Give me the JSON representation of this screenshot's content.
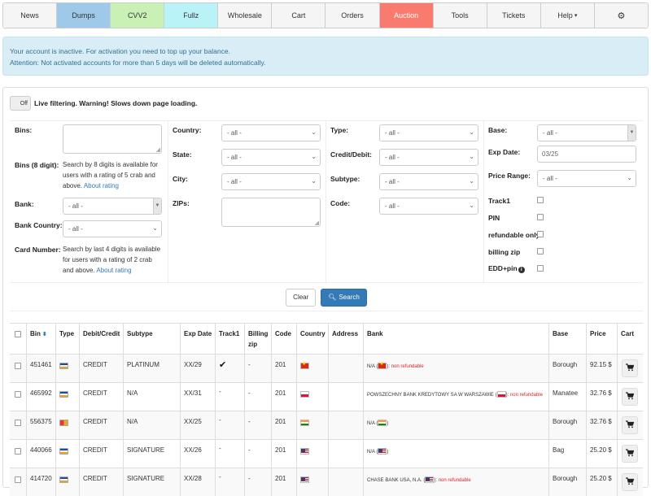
{
  "nav": {
    "tabs": [
      {
        "label": "News",
        "bg": "#f5f5f5",
        "active": false
      },
      {
        "label": "Dumps",
        "bg": "#9fc9e8",
        "active": true
      },
      {
        "label": "CVV2",
        "bg": "#c9f0b5",
        "active": false
      },
      {
        "label": "Fullz",
        "bg": "#b9f2f7",
        "active": false
      },
      {
        "label": "Wholesale",
        "bg": "#f5f5f5",
        "active": false
      },
      {
        "label": "Cart",
        "bg": "#f5f5f5",
        "active": false
      },
      {
        "label": "Orders",
        "bg": "#f5f5f5",
        "active": false
      },
      {
        "label": "Auction",
        "bg": "#f97b70",
        "active": false,
        "color": "#ffffff"
      },
      {
        "label": "Tools",
        "bg": "#f5f5f5",
        "active": false
      },
      {
        "label": "Tickets",
        "bg": "#f5f5f5",
        "active": false
      },
      {
        "label": "Help",
        "bg": "#f5f5f5",
        "active": false,
        "dropdown": true
      },
      {
        "label": "",
        "bg": "#f5f5f5",
        "active": false,
        "icon": "gear-icon"
      }
    ]
  },
  "alert": {
    "line1_prefix": "Your account is inactive. For activation you need ",
    "line1_link": "to top up your balance.",
    "line2": "Attention: Not activated accounts for more than 5 days will be deleted automatically."
  },
  "live_filter": {
    "toggle_label": "Off",
    "text": "Live filtering. Warning! Slows down page loading."
  },
  "filters": {
    "bins_label": "Bins:",
    "bins8_label": "Bins (8 digit):",
    "bins8_help": "Search by 8 digits is available for users with a rating of 5 crab and above.",
    "about_rating": "About rating",
    "bank_label": "Bank:",
    "bank_value": "- all -",
    "bank_country_label": "Bank Country:",
    "bank_country_value": "- all -",
    "card_number_label": "Card Number:",
    "card_number_help": "Search by last 4 digits is available for users with a rating of 2 crab and above.",
    "country_label": "Country:",
    "country_value": "- all -",
    "state_label": "State:",
    "state_value": "- all -",
    "city_label": "City:",
    "city_value": "- all -",
    "zips_label": "ZIPs:",
    "type_label": "Type:",
    "type_value": "- all -",
    "credit_debit_label": "Credit/Debit:",
    "credit_debit_value": "- all -",
    "subtype_label": "Subtype:",
    "subtype_value": "- all -",
    "code_label": "Code:",
    "code_value": "- all -",
    "base_label": "Base:",
    "base_value": "- all -",
    "exp_date_label": "Exp Date:",
    "exp_date_placeholder": "03/25",
    "price_range_label": "Price Range:",
    "price_range_value": "- all -",
    "track1_label": "Track1",
    "pin_label": "PIN",
    "refundable_label": "refundable only",
    "billing_zip_label": "billing zip",
    "edd_pin_label": "EDD+pin"
  },
  "buttons": {
    "clear": "Clear",
    "search": "Search"
  },
  "table": {
    "headers": {
      "bin": "Bin",
      "type": "Type",
      "debit_credit": "Debit/Credit",
      "subtype": "Subtype",
      "exp_date": "Exp Date",
      "track1": "Track1",
      "billing_zip_1": "Billing",
      "billing_zip_2": "zip",
      "code": "Code",
      "country": "Country",
      "address": "Address",
      "bank": "Bank",
      "base": "Base",
      "price": "Price",
      "cart": "Cart"
    },
    "rows": [
      {
        "bin": "451461",
        "card": "visa",
        "debit_credit": "CREDIT",
        "subtype": "PLATINUM",
        "exp": "XX/29",
        "track1": "✔",
        "billing_zip": "-",
        "code": "201",
        "flag": "cn",
        "bank": "N/A (",
        "bank_suffix": "): ",
        "refund": "non refundable",
        "base": "Borough",
        "price": "92.15 $"
      },
      {
        "bin": "465992",
        "card": "visa",
        "debit_credit": "CREDIT",
        "subtype": "N/A",
        "exp": "XX/31",
        "track1": "-",
        "billing_zip": "-",
        "code": "201",
        "flag": "pl",
        "bank": "POWSZECHNY BANK KREDYTOWY SA W WARSZAWIE (",
        "bank_suffix": "): ",
        "refund": "non refundable",
        "base": "Manatee",
        "price": "32.76 $"
      },
      {
        "bin": "556375",
        "card": "mc",
        "debit_credit": "CREDIT",
        "subtype": "N/A",
        "exp": "XX/25",
        "track1": "-",
        "billing_zip": "-",
        "code": "201",
        "flag": "in",
        "bank": "N/A (",
        "bank_suffix": ")",
        "refund": "",
        "base": "Borough",
        "price": "32.76 $"
      },
      {
        "bin": "440066",
        "card": "visa",
        "debit_credit": "CREDIT",
        "subtype": "SIGNATURE",
        "exp": "XX/26",
        "track1": "-",
        "billing_zip": "-",
        "code": "201",
        "flag": "us",
        "bank": "N/A (",
        "bank_suffix": ")",
        "refund": "",
        "base": "Bag",
        "price": "25.20 $"
      },
      {
        "bin": "414720",
        "card": "visa",
        "debit_credit": "CREDIT",
        "subtype": "SIGNATURE",
        "exp": "XX/28",
        "track1": "-",
        "billing_zip": "-",
        "code": "201",
        "flag": "us",
        "bank": "CHASE BANK USA, N.A. (",
        "bank_suffix": "): ",
        "refund": "non refundable",
        "base": "Borough",
        "price": "25.20 $"
      }
    ]
  }
}
